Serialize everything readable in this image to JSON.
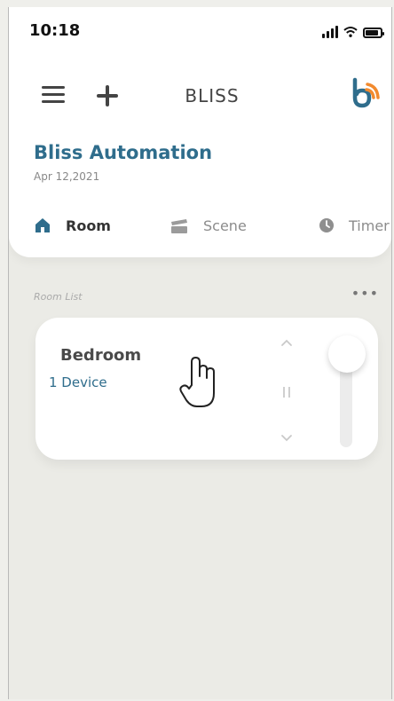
{
  "status_bar": {
    "time": "10:18"
  },
  "header": {
    "title": "BLISS",
    "menu_icon": "menu-icon",
    "add_icon": "plus-icon",
    "logo": "bliss-logo-icon",
    "colors": {
      "brand_blue": "#2f6d8c",
      "brand_orange": "#f28a2e"
    }
  },
  "brand": {
    "name": "Bliss Automation",
    "date": "Apr 12,2021"
  },
  "tabs": [
    {
      "label": "Room",
      "icon": "home-icon",
      "active": true
    },
    {
      "label": "Scene",
      "icon": "scene-icon",
      "active": false
    },
    {
      "label": "Timer",
      "icon": "clock-icon",
      "active": false
    }
  ],
  "room_list": {
    "label": "Room List",
    "more_icon": "more-icon",
    "rooms": [
      {
        "name": "Bedroom",
        "devices": "1 Device",
        "controls": [
          "chevron-up-icon",
          "pause-icon",
          "chevron-down-icon"
        ],
        "slider": "vertical-slider"
      }
    ]
  },
  "overlay": {
    "cursor_icon": "hand-cursor-icon"
  }
}
